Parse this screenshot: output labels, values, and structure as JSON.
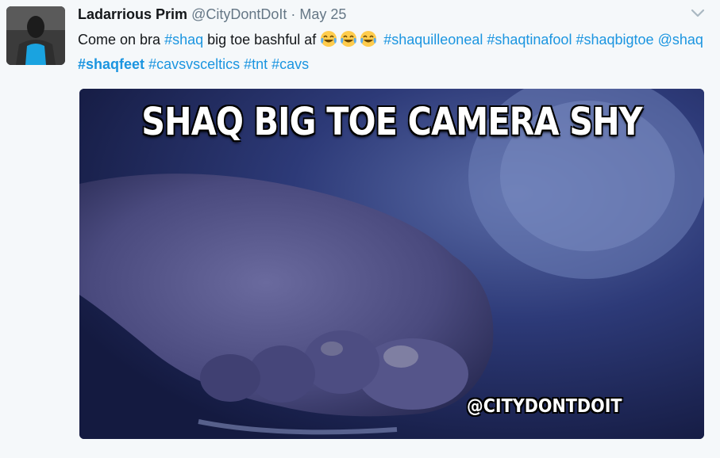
{
  "tweet": {
    "author": {
      "name": "Ladarrious Prim",
      "handle": "@CityDontDoIt",
      "separator": "·",
      "date": "May 25"
    },
    "text": {
      "prefix": "Come on bra ",
      "tag_shaq": "#shaq",
      "middle": " big toe bashful af ",
      "emoji_names": [
        "face-with-tears-of-joy-icon",
        "face-with-tears-of-joy-icon",
        "face-with-tears-of-joy-icon"
      ],
      "tag_shaquilleoneal": "#shaquilleoneal",
      "tag_shaqtinafool": "#shaqtinafool",
      "tag_shaqbigtoe": "#shaqbigtoe",
      "mention_shaq": "@shaq",
      "tag_shaqfeet": "#shaqfeet",
      "tag_cavsvsceltics": "#cavsvsceltics",
      "tag_tnt": "#tnt",
      "tag_cavs": "#cavs"
    },
    "media": {
      "caption": "SHAQ BIG TOE CAMERA SHY",
      "watermark": "@CITYDONTDOIT"
    }
  },
  "colors": {
    "link": "#1b95e0",
    "text": "#14171a",
    "muted": "#657786",
    "background": "#f5f8fa"
  }
}
